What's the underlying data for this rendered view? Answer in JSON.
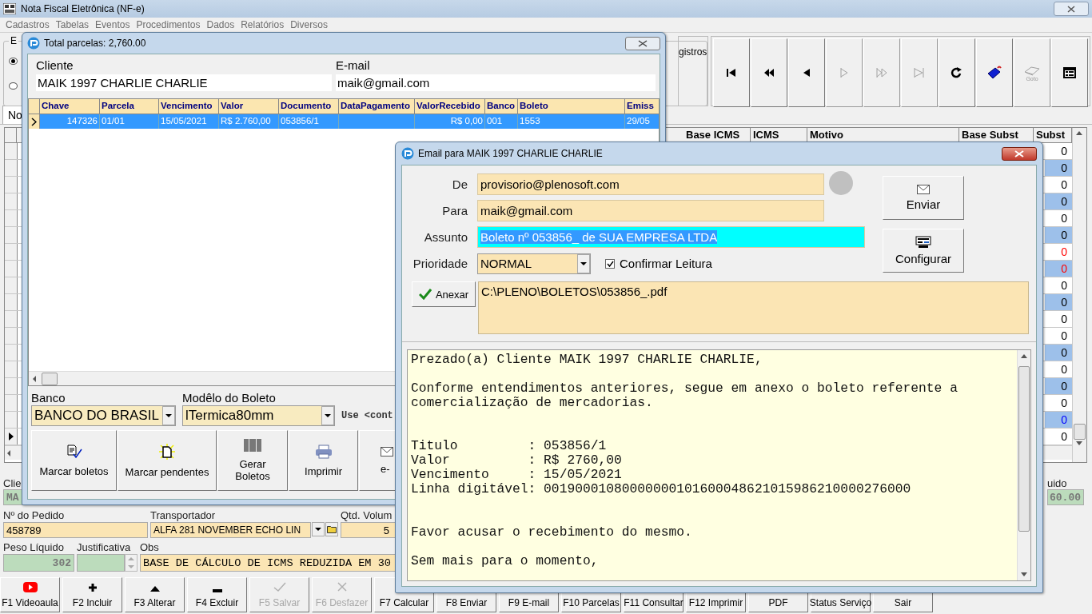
{
  "main_window": {
    "title": "Nota Fiscal Eletrônica (NF-e)",
    "menu": [
      "Cadastros",
      "Tabelas",
      "Eventos",
      "Procedimentos",
      "Dados",
      "Relatórios",
      "Diversos"
    ],
    "group_label": "E",
    "radios": [
      {
        "selected": true
      },
      {
        "selected": false
      }
    ],
    "registros_label": "gistros",
    "nav_buttons": [
      {
        "kind": "first",
        "disabled": false
      },
      {
        "kind": "prev-page",
        "disabled": false
      },
      {
        "kind": "prev",
        "disabled": false
      },
      {
        "kind": "next",
        "disabled": true
      },
      {
        "kind": "next-page",
        "disabled": true
      },
      {
        "kind": "last",
        "disabled": true
      },
      {
        "kind": "refresh",
        "disabled": false
      },
      {
        "kind": "tag",
        "disabled": false
      },
      {
        "kind": "goto",
        "label": "Goto",
        "disabled": true
      },
      {
        "kind": "form",
        "disabled": false
      }
    ],
    "tab_label": "No",
    "grid": {
      "columns": [
        "Base ICMS",
        "ICMS",
        "Motivo",
        "Base Subst",
        "Subst"
      ],
      "rows": [
        {
          "subst": "0",
          "color": "#000000",
          "shaded": false,
          "selected": false
        },
        {
          "subst": "0",
          "color": "#000000",
          "shaded": true,
          "selected": false
        },
        {
          "subst": "0",
          "color": "#000000",
          "shaded": false,
          "selected": false
        },
        {
          "subst": "0",
          "color": "#000000",
          "shaded": true,
          "selected": false
        },
        {
          "subst": "0",
          "color": "#000000",
          "shaded": false,
          "selected": false
        },
        {
          "subst": "0",
          "color": "#000000",
          "shaded": true,
          "selected": false
        },
        {
          "subst": "0",
          "color": "#ff0000",
          "shaded": false,
          "selected": false
        },
        {
          "subst": "0",
          "color": "#ff0000",
          "shaded": true,
          "selected": false
        },
        {
          "subst": "0",
          "color": "#000000",
          "shaded": false,
          "selected": false
        },
        {
          "subst": "0",
          "color": "#000000",
          "shaded": true,
          "selected": false
        },
        {
          "subst": "0",
          "color": "#000000",
          "shaded": false,
          "selected": false
        },
        {
          "subst": "0",
          "color": "#000000",
          "shaded": false,
          "selected": false
        },
        {
          "subst": "0",
          "color": "#000000",
          "shaded": true,
          "selected": false
        },
        {
          "subst": "0",
          "color": "#000000",
          "shaded": false,
          "selected": false
        },
        {
          "subst": "0",
          "color": "#000000",
          "shaded": true,
          "selected": false
        },
        {
          "subst": "0",
          "color": "#000000",
          "shaded": false,
          "selected": false
        },
        {
          "subst": "0",
          "color": "#0000ff",
          "shaded": true,
          "selected": false
        },
        {
          "subst": "0",
          "color": "#000000",
          "shaded": false,
          "selected": true
        }
      ]
    },
    "cliente_label": "Clie",
    "cliente_value": "MA",
    "liquido_label": "uido",
    "liquido_value": "60.00",
    "pedido": {
      "label": "Nº do Pedido",
      "value": "458789"
    },
    "transportador": {
      "label": "Transportador",
      "value": "ALFA 281 NOVEMBER ECHO LIN"
    },
    "qtd_volumes": {
      "label": "Qtd. Volum",
      "value": "5"
    },
    "peso_liquido": {
      "label": "Peso Líquido",
      "value": "302"
    },
    "justificativa": {
      "label": "Justificativa"
    },
    "obs": {
      "label": "Obs",
      "value": "BASE DE CÁLCULO DE ICMS REDUZIDA EM  30"
    },
    "function_keys": [
      {
        "label": "F1 Videoaula",
        "disabled": false
      },
      {
        "label": "F2 Incluir",
        "disabled": false
      },
      {
        "label": "F3 Alterar",
        "disabled": false
      },
      {
        "label": "F4 Excluir",
        "disabled": false
      },
      {
        "label": "F5 Salvar",
        "disabled": true
      },
      {
        "label": "F6 Desfazer",
        "disabled": true
      },
      {
        "label": "F7 Calcular",
        "disabled": false
      },
      {
        "label": "F8 Enviar",
        "disabled": false
      },
      {
        "label": "F9 E-mail",
        "disabled": false
      },
      {
        "label": "F10 Parcelas",
        "disabled": false
      },
      {
        "label": "F11 Consultar",
        "disabled": false
      },
      {
        "label": "F12 Imprimir",
        "disabled": false
      },
      {
        "label": "PDF",
        "disabled": false
      },
      {
        "label": "Status Serviço",
        "disabled": false
      },
      {
        "label": "Sair",
        "disabled": false
      }
    ]
  },
  "parcelas_window": {
    "title": "Total parcelas: 2,760.00",
    "cliente": {
      "label": "Cliente",
      "value": "MAIK 1997 CHARLIE CHARLIE"
    },
    "email": {
      "label": "E-mail",
      "value": "maik@gmail.com"
    },
    "columns": [
      "Chave",
      "Parcela",
      "Vencimento",
      "Valor",
      "Documento",
      "DataPagamento",
      "ValorRecebido",
      "Banco",
      "Boleto",
      "Emiss"
    ],
    "rows": [
      {
        "cells": [
          "147326",
          "01/01",
          "15/05/2021",
          "R$ 2.760,00",
          "053856/1",
          "",
          "R$ 0,00",
          "001",
          "1553",
          "29/05"
        ],
        "selected": true
      }
    ],
    "banco": {
      "label": "Banco",
      "value": "BANCO DO BRASIL"
    },
    "modelo": {
      "label": "Modêlo do Boleto",
      "value": "lTermica80mm"
    },
    "hint": "Use <cont",
    "buttons": [
      "Marcar boletos",
      "Marcar pendentes",
      "Gerar Boletos",
      "Imprimir",
      "e-"
    ]
  },
  "email_window": {
    "title": "Email para MAIK 1997 CHARLIE CHARLIE",
    "from": {
      "label": "De",
      "value": "provisorio@plenosoft.com"
    },
    "to": {
      "label": "Para",
      "value": "maik@gmail.com"
    },
    "subject": {
      "label": "Assunto",
      "value": "Boleto nº 053856_ de SUA EMPRESA LTDA",
      "selected": true
    },
    "priority": {
      "label": "Prioridade",
      "value": "NORMAL"
    },
    "confirm_read": {
      "label": "Confirmar Leitura",
      "checked": true
    },
    "buttons": [
      "Enviar",
      "Configurar"
    ],
    "attach_button": "Anexar",
    "attachment": "C:\\PLENO\\BOLETOS\\053856_.pdf",
    "body": "Prezado(a) Cliente MAIK 1997 CHARLIE CHARLIE,\n\nConforme entendimentos anteriores, segue em anexo o boleto referente a\ncomercialização de mercadorias.\n\n\nTitulo         : 053856/1\nValor          : R$ 2760,00\nVencimento     : 15/05/2021\nLinha digitável: 00190001080000000101600048621015986210000276000\n\n\nFavor acusar o recebimento do mesmo.\n\nSem mais para o momento,"
  }
}
